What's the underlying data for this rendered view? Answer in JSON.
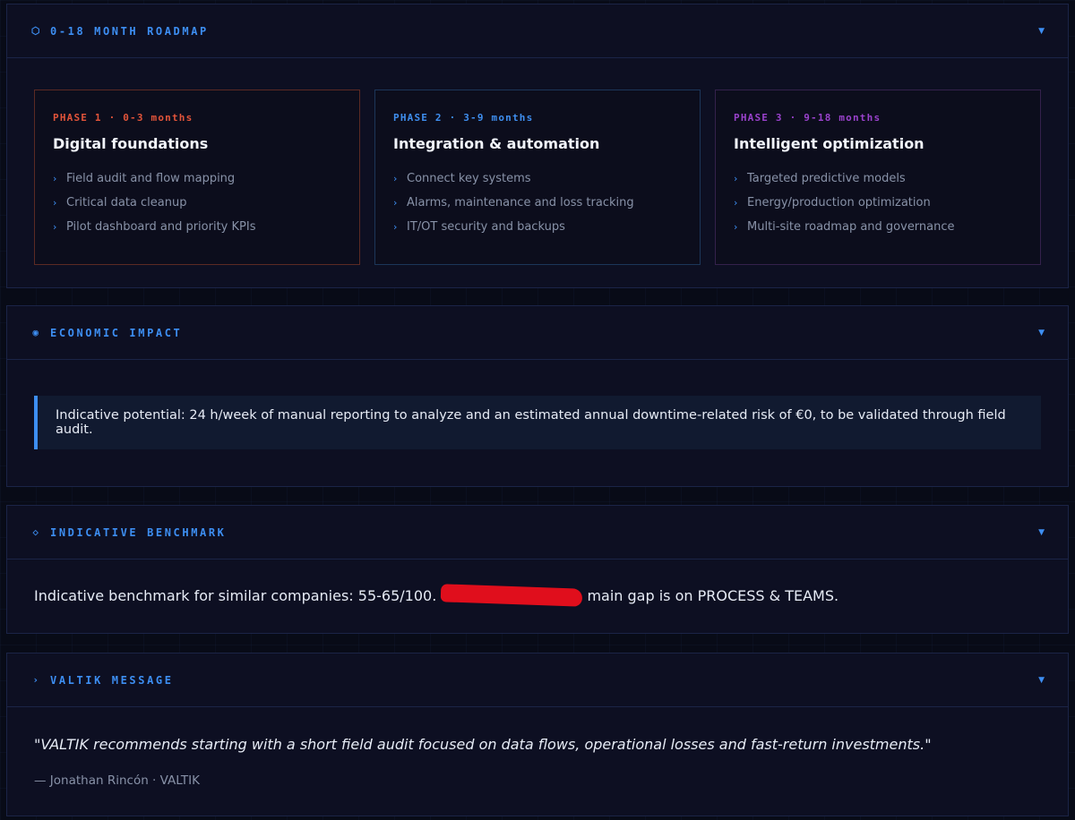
{
  "roadmap": {
    "icon": "hexagon-icon",
    "title": "0-18 MONTH ROADMAP",
    "phases": [
      {
        "tag": "PHASE 1 · 0-3 months",
        "color": "#e2543a",
        "title": "Digital foundations",
        "items": [
          "Field audit and flow mapping",
          "Critical data cleanup",
          "Pilot dashboard and priority KPIs"
        ]
      },
      {
        "tag": "PHASE 2 · 3-9 months",
        "color": "#3f8ff0",
        "title": "Integration & automation",
        "items": [
          "Connect key systems",
          "Alarms, maintenance and loss tracking",
          "IT/OT security and backups"
        ]
      },
      {
        "tag": "PHASE 3 · 9-18 months",
        "color": "#9a42cc",
        "title": "Intelligent optimization",
        "items": [
          "Targeted predictive models",
          "Energy/production optimization",
          "Multi-site roadmap and governance"
        ]
      }
    ]
  },
  "economic": {
    "icon": "target-icon",
    "title": "ECONOMIC IMPACT",
    "text": "Indicative potential: 24 h/week of manual reporting to analyze and an estimated annual downtime-related risk of €0, to be validated through field audit."
  },
  "benchmark": {
    "icon": "diamond-icon",
    "title": "INDICATIVE BENCHMARK",
    "text_before": "Indicative benchmark for similar companies: 55-65/100. ",
    "text_after": " main gap is on PROCESS & TEAMS."
  },
  "message": {
    "icon": "chevron-right-icon",
    "title": "VALTIK MESSAGE",
    "quote": "\"VALTIK recommends starting with a short field audit focused on data flows, operational losses and fast-return investments.\"",
    "attribution": "— Jonathan Rincón · VALTIK"
  },
  "caret_icon": "caret-down-icon",
  "accent_color": "#3d8ef2"
}
